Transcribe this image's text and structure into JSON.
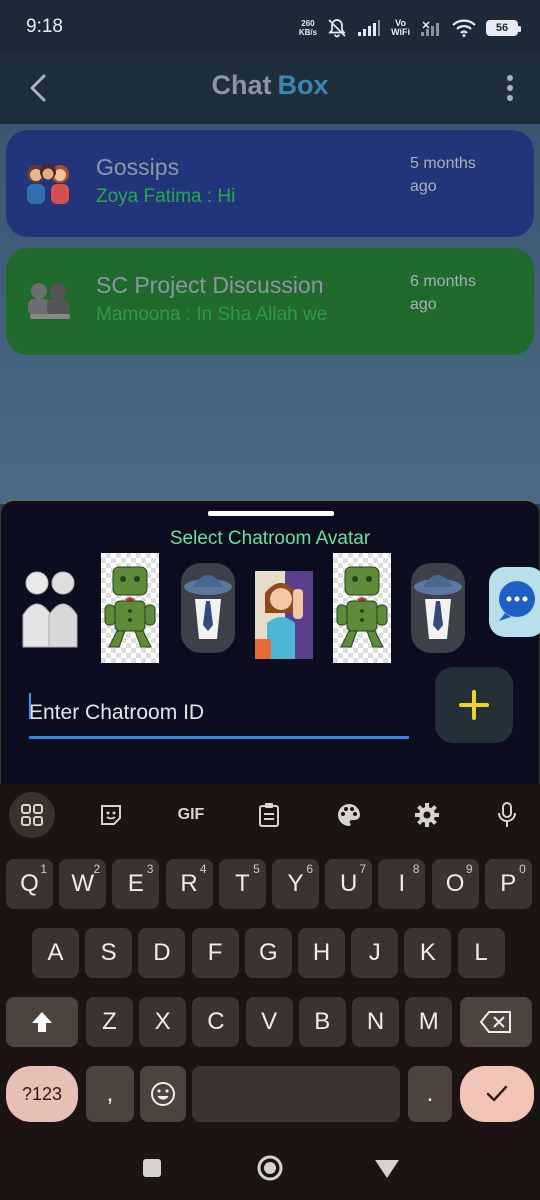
{
  "status_bar": {
    "time": "9:18",
    "net_speed_value": "260",
    "net_speed_unit": "KB/s",
    "vowifi_line1": "Vo",
    "vowifi_line2": "WiFi",
    "battery": "56"
  },
  "app_bar": {
    "title_part1": "Chat",
    "title_part2": "Box",
    "back_icon": "chevron-left-icon",
    "menu_icon": "more-vert-icon"
  },
  "chat_rooms": [
    {
      "name": "Gossips",
      "last_message": "Zoya Fatima : Hi",
      "time_line1": "5 months",
      "time_line2": "ago",
      "color": "#23357a"
    },
    {
      "name": "SC Project Discussion",
      "last_message": "Mamoona : In Sha Allah we",
      "time_line1": "6 months",
      "time_line2": "ago",
      "color": "#1f6a2c"
    }
  ],
  "sheet": {
    "title": "Select Chatroom Avatar",
    "avatars": [
      "group-figures-avatar",
      "green-robot-avatar",
      "hat-tie-avatar",
      "girl-avatar",
      "green-robot-avatar",
      "hat-tie-avatar",
      "chat-bubble-avatar"
    ],
    "input_placeholder": "Enter Chatroom ID",
    "add_icon": "plus-icon"
  },
  "keyboard": {
    "tools": [
      "apps-grid-icon",
      "sticker-icon",
      "GIF",
      "clipboard-icon",
      "palette-icon",
      "gear-icon",
      "mic-icon"
    ],
    "row1": [
      {
        "k": "Q",
        "n": "1"
      },
      {
        "k": "W",
        "n": "2"
      },
      {
        "k": "E",
        "n": "3"
      },
      {
        "k": "R",
        "n": "4"
      },
      {
        "k": "T",
        "n": "5"
      },
      {
        "k": "Y",
        "n": "6"
      },
      {
        "k": "U",
        "n": "7"
      },
      {
        "k": "I",
        "n": "8"
      },
      {
        "k": "O",
        "n": "9"
      },
      {
        "k": "P",
        "n": "0"
      }
    ],
    "row2": [
      "A",
      "S",
      "D",
      "F",
      "G",
      "H",
      "J",
      "K",
      "L"
    ],
    "row3": [
      "Z",
      "X",
      "C",
      "V",
      "B",
      "N",
      "M"
    ],
    "sym_label": "?123",
    "comma": ",",
    "period": ".",
    "emoji_icon": "smiley-icon",
    "shift_icon": "shift-icon",
    "backspace_icon": "backspace-icon",
    "enter_icon": "checkmark-icon"
  },
  "nav_bar": [
    "square-icon",
    "circle-home-icon",
    "triangle-back-icon"
  ]
}
